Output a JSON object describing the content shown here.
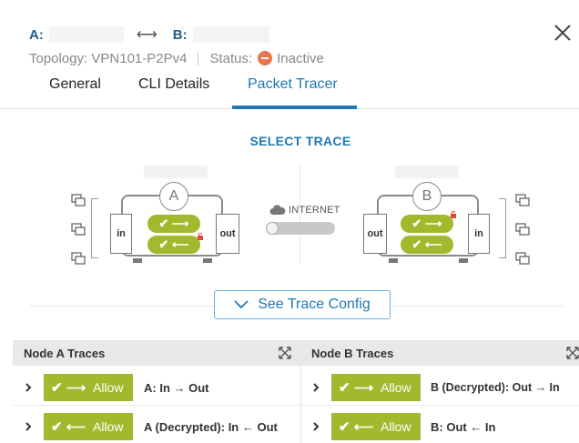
{
  "header": {
    "endpoint_a_label": "A:",
    "endpoint_b_label": "B:",
    "arrow": "⟷",
    "topology": "Topology: VPN101-P2Pv4",
    "status_label": "Status:",
    "status_value": "Inactive",
    "status_color": "#e9754f"
  },
  "tabs": [
    {
      "label": "General",
      "active": false
    },
    {
      "label": "CLI Details",
      "active": false
    },
    {
      "label": "Packet Tracer",
      "active": true
    }
  ],
  "select_trace": {
    "title": "SELECT TRACE",
    "node_a": {
      "letter": "A",
      "port_in": "in",
      "port_out": "out"
    },
    "node_b": {
      "letter": "B",
      "port_in": "in",
      "port_out": "out"
    },
    "internet_label": "INTERNET",
    "see_config_label": "See Trace Config"
  },
  "traces": {
    "node_a": {
      "title": "Node A Traces",
      "rows": [
        {
          "glyph": "✔ ⟶",
          "action": "Allow",
          "description": "A: In → Out"
        },
        {
          "glyph": "✔ ⟵",
          "action": "Allow",
          "description": "A (Decrypted): In ← Out"
        }
      ]
    },
    "node_b": {
      "title": "Node B Traces",
      "rows": [
        {
          "glyph": "✔ ⟶",
          "action": "Allow",
          "description": "B (Decrypted): Out → In"
        },
        {
          "glyph": "✔ ⟵",
          "action": "Allow",
          "description": "B: Out ← In"
        }
      ]
    }
  },
  "colors": {
    "accent": "#1f78b4",
    "allow_green": "#a3b82d",
    "header_bg": "#e8e8e8"
  }
}
